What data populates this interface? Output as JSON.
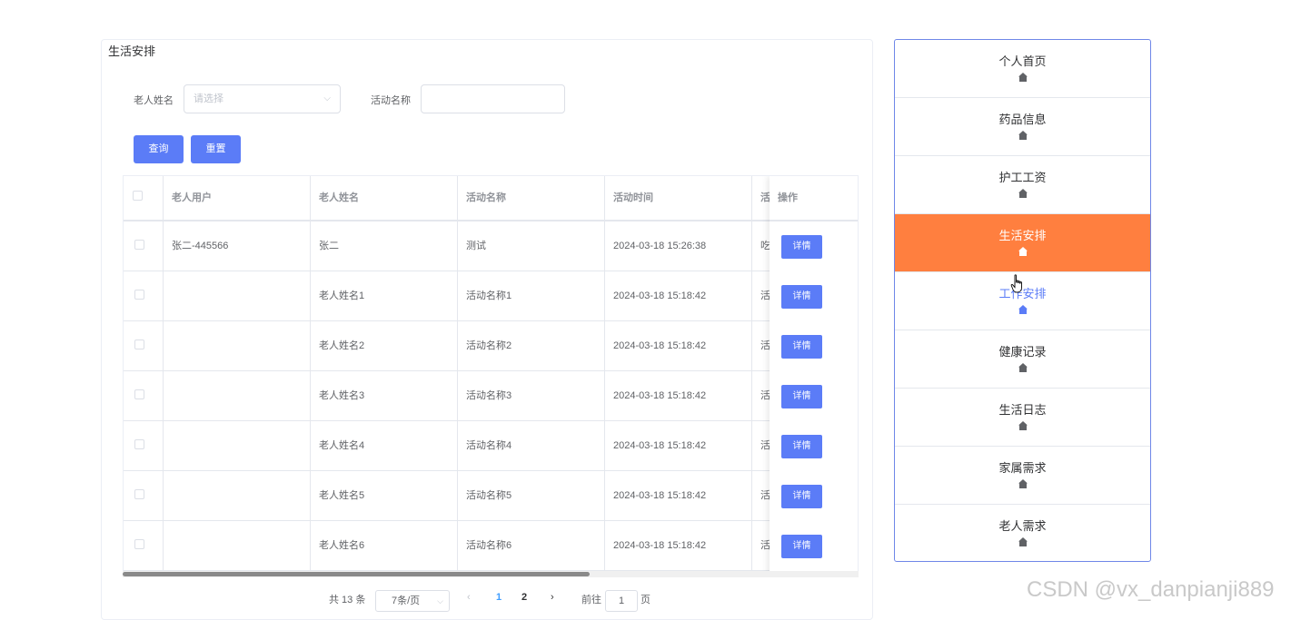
{
  "panel": {
    "title": "生活安排"
  },
  "form": {
    "name_label": "老人姓名",
    "name_placeholder": "请选择",
    "activity_label": "活动名称",
    "activity_value": "",
    "query_label": "查询",
    "reset_label": "重置"
  },
  "table": {
    "headers": [
      "老人用户",
      "老人姓名",
      "活动名称",
      "活动时间",
      "活",
      "操作"
    ],
    "rows": [
      {
        "user": "张二-445566",
        "name": "张二",
        "activity": "测试",
        "time": "2024-03-18 15:26:38",
        "extra": "吃",
        "action": "详情"
      },
      {
        "user": "",
        "name": "老人姓名1",
        "activity": "活动名称1",
        "time": "2024-03-18 15:18:42",
        "extra": "活",
        "action": "详情"
      },
      {
        "user": "",
        "name": "老人姓名2",
        "activity": "活动名称2",
        "time": "2024-03-18 15:18:42",
        "extra": "活",
        "action": "详情"
      },
      {
        "user": "",
        "name": "老人姓名3",
        "activity": "活动名称3",
        "time": "2024-03-18 15:18:42",
        "extra": "活",
        "action": "详情"
      },
      {
        "user": "",
        "name": "老人姓名4",
        "activity": "活动名称4",
        "time": "2024-03-18 15:18:42",
        "extra": "活",
        "action": "详情"
      },
      {
        "user": "",
        "name": "老人姓名5",
        "activity": "活动名称5",
        "time": "2024-03-18 15:18:42",
        "extra": "活",
        "action": "详情"
      },
      {
        "user": "",
        "name": "老人姓名6",
        "activity": "活动名称6",
        "time": "2024-03-18 15:18:42",
        "extra": "活",
        "action": "详情"
      }
    ]
  },
  "pagination": {
    "total": "共 13 条",
    "page_size": "7条/页",
    "prev": "‹",
    "pages": [
      "1",
      "2"
    ],
    "current_page": "1",
    "next": "›",
    "goto_label": "前往",
    "goto_value": "1",
    "goto_suffix": "页"
  },
  "menu": {
    "items": [
      {
        "label": "个人首页",
        "state": "normal"
      },
      {
        "label": "药品信息",
        "state": "normal"
      },
      {
        "label": "护工工资",
        "state": "normal"
      },
      {
        "label": "生活安排",
        "state": "active"
      },
      {
        "label": "工作安排",
        "state": "hover"
      },
      {
        "label": "健康记录",
        "state": "normal"
      },
      {
        "label": "生活日志",
        "state": "normal"
      },
      {
        "label": "家属需求",
        "state": "normal"
      },
      {
        "label": "老人需求",
        "state": "normal"
      }
    ],
    "icon": "home-icon"
  },
  "watermark": "CSDN @vx_danpianji889",
  "colors": {
    "primary": "#5b7cf7",
    "active_menu": "#ff7f3f",
    "menu_border": "#6f87e8"
  }
}
